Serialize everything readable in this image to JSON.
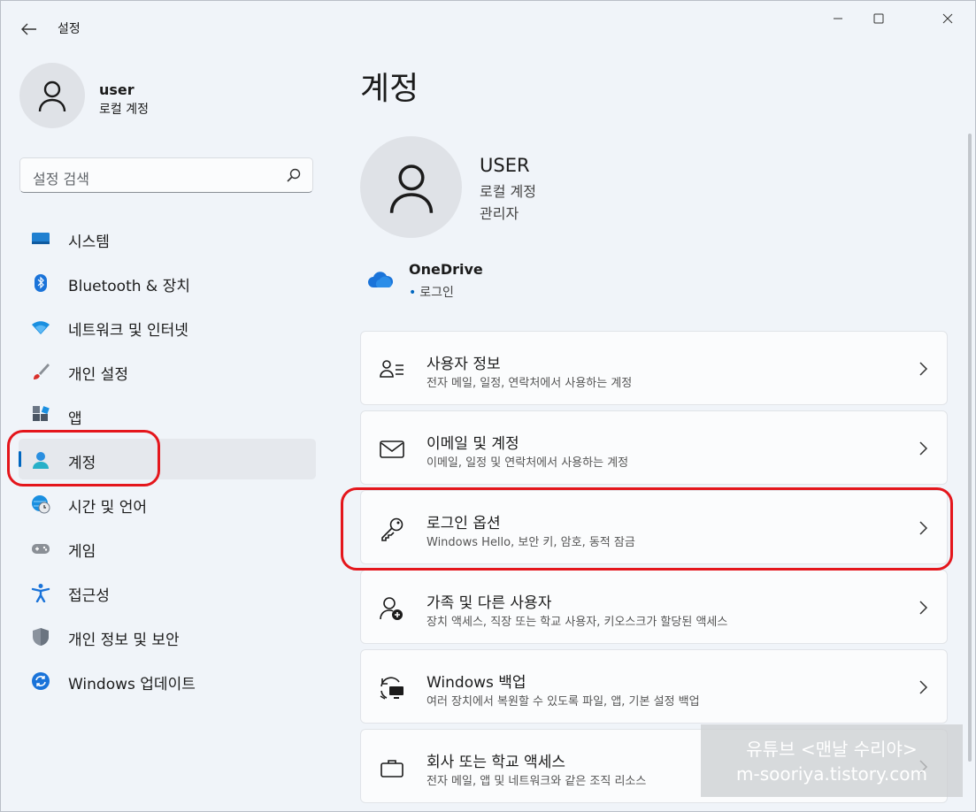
{
  "window": {
    "title": "설정"
  },
  "sidebar": {
    "user": {
      "name": "user",
      "type": "로컬 계정"
    },
    "search": {
      "placeholder": "설정 검색"
    },
    "items": [
      {
        "label": "시스템",
        "icon": "monitor-icon"
      },
      {
        "label": "Bluetooth & 장치",
        "icon": "bluetooth-icon"
      },
      {
        "label": "네트워크 및 인터넷",
        "icon": "wifi-icon"
      },
      {
        "label": "개인 설정",
        "icon": "brush-icon"
      },
      {
        "label": "앱",
        "icon": "apps-icon"
      },
      {
        "label": "계정",
        "icon": "account-icon",
        "active": true
      },
      {
        "label": "시간 및 언어",
        "icon": "globe-clock-icon"
      },
      {
        "label": "게임",
        "icon": "gamepad-icon"
      },
      {
        "label": "접근성",
        "icon": "accessibility-icon"
      },
      {
        "label": "개인 정보 및 보안",
        "icon": "shield-icon"
      },
      {
        "label": "Windows 업데이트",
        "icon": "update-icon"
      }
    ]
  },
  "main": {
    "title": "계정",
    "user": {
      "name": "USER",
      "type": "로컬 계정",
      "role": "관리자"
    },
    "onedrive": {
      "name": "OneDrive",
      "status": "로그인"
    },
    "cards": [
      {
        "title": "사용자 정보",
        "subtitle": "전자 메일, 일정, 연락처에서 사용하는 계정",
        "icon": "person-list-icon"
      },
      {
        "title": "이메일 및 계정",
        "subtitle": "이메일, 일정 및 연락처에서 사용하는 계정",
        "icon": "mail-icon"
      },
      {
        "title": "로그인 옵션",
        "subtitle": "Windows Hello, 보안 키, 암호, 동적 잠금",
        "icon": "key-icon"
      },
      {
        "title": "가족 및 다른 사용자",
        "subtitle": "장치 액세스, 직장 또는 학교 사용자, 키오스크가 할당된 액세스",
        "icon": "person-add-icon"
      },
      {
        "title": "Windows 백업",
        "subtitle": "여러 장치에서 복원할 수 있도록 파일, 앱, 기본 설정 백업",
        "icon": "backup-icon"
      },
      {
        "title": "회사 또는 학교 액세스",
        "subtitle": "전자 메일, 앱 및 네트워크와 같은 조직 리소스",
        "icon": "briefcase-icon"
      }
    ]
  },
  "watermark": {
    "line1": "유튜브 <맨날 수리야>",
    "line2": "m-sooriya.tistory.com"
  },
  "colors": {
    "accent": "#0067c0",
    "highlight": "#e4161c"
  }
}
